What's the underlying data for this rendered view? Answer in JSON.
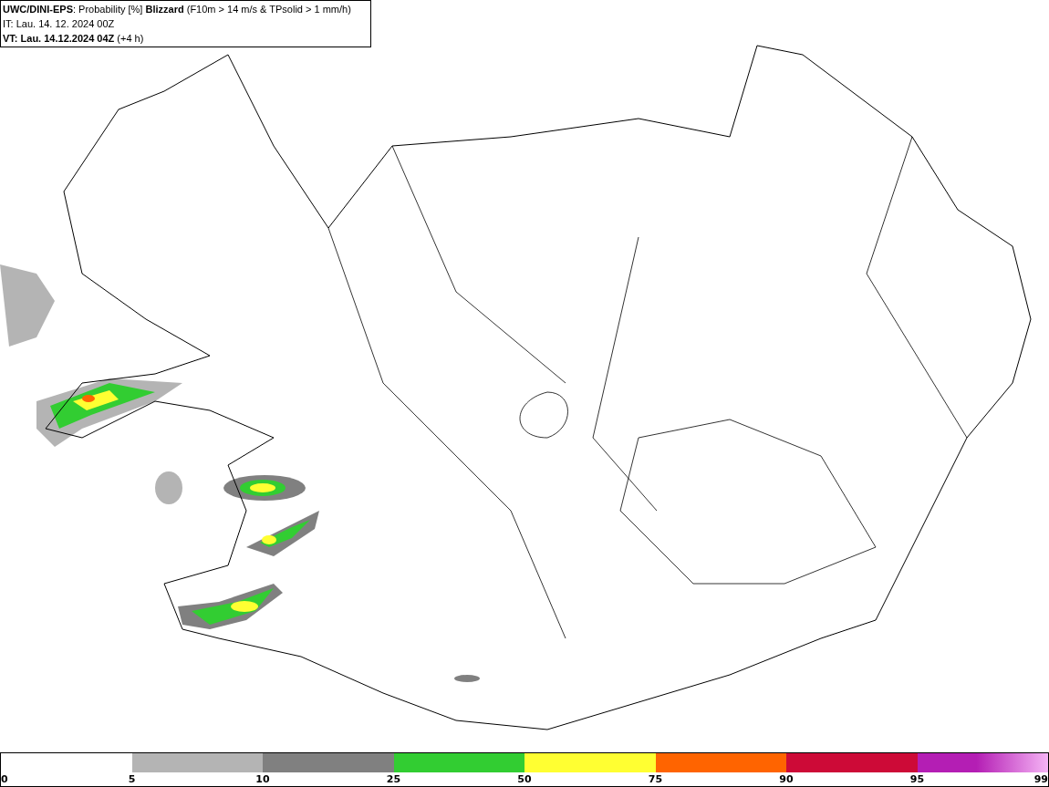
{
  "header": {
    "lines": [
      "**UWC/DINI-EPS**: Probability [%] **Blizzard** (F10m > 14 m/s & TPsolid > 1 mm/h)",
      "IT: Lau. 14. 12. 2024 00Z",
      "**VT: Lau. 14.12.2024 04Z** (+4 h)"
    ]
  },
  "legend": {
    "segments": [
      {
        "kind": "blank"
      },
      {
        "kind": "solid",
        "color": "#b4b4b4"
      },
      {
        "kind": "solid",
        "color": "#808080"
      },
      {
        "kind": "solid",
        "color": "#32cd32"
      },
      {
        "kind": "solid",
        "color": "#ffff32"
      },
      {
        "kind": "solid",
        "color": "#ff6400"
      },
      {
        "kind": "solid",
        "color": "#cd0a37"
      },
      {
        "kind": "gradient",
        "color": "#b41eb4"
      }
    ],
    "ticks": [
      "0",
      "5",
      "10",
      "25",
      "50",
      "75",
      "90",
      "95",
      "99"
    ]
  }
}
